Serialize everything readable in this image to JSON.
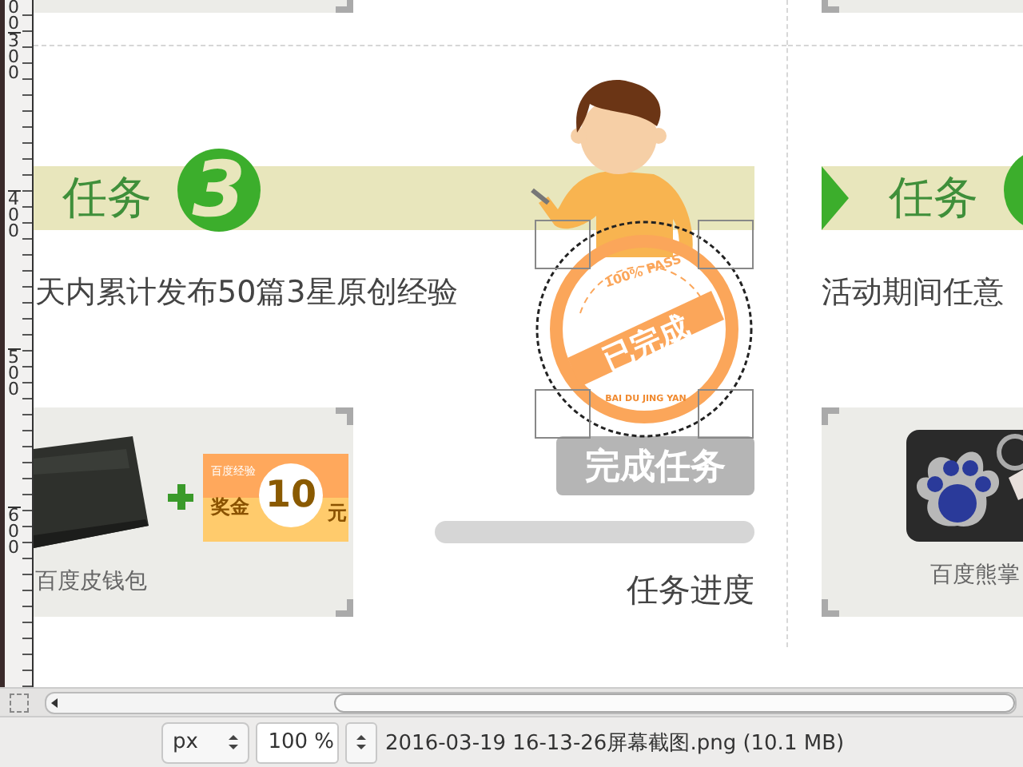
{
  "ruler": {
    "labels": [
      "00",
      "300",
      "400",
      "500",
      "600"
    ]
  },
  "tasks": [
    {
      "marker": false,
      "banner_label": "任务",
      "number": "3",
      "description": "天内累计发布50篇3星原创经验",
      "prize": {
        "kind": "wallet",
        "caption": "百度皮钱包",
        "coupon": {
          "header": "百度经验",
          "amount": "10",
          "label": "奖金",
          "unit": "元"
        }
      },
      "button": "完成任务",
      "progress": {
        "level": 0
      },
      "progress_label": "任务进度",
      "stamp": {
        "top": "100% PASS",
        "center": "已完成",
        "bottom": "BAI DU JING YAN"
      }
    },
    {
      "marker": true,
      "banner_label": "任务",
      "description": "活动期间任意",
      "prize": {
        "kind": "keychain",
        "caption": "百度熊掌"
      }
    }
  ],
  "status_bar": {
    "unit": "px",
    "zoom": "100 %",
    "file": "2016-03-19 16-13-26屏幕截图.png (10.1 MB)"
  }
}
